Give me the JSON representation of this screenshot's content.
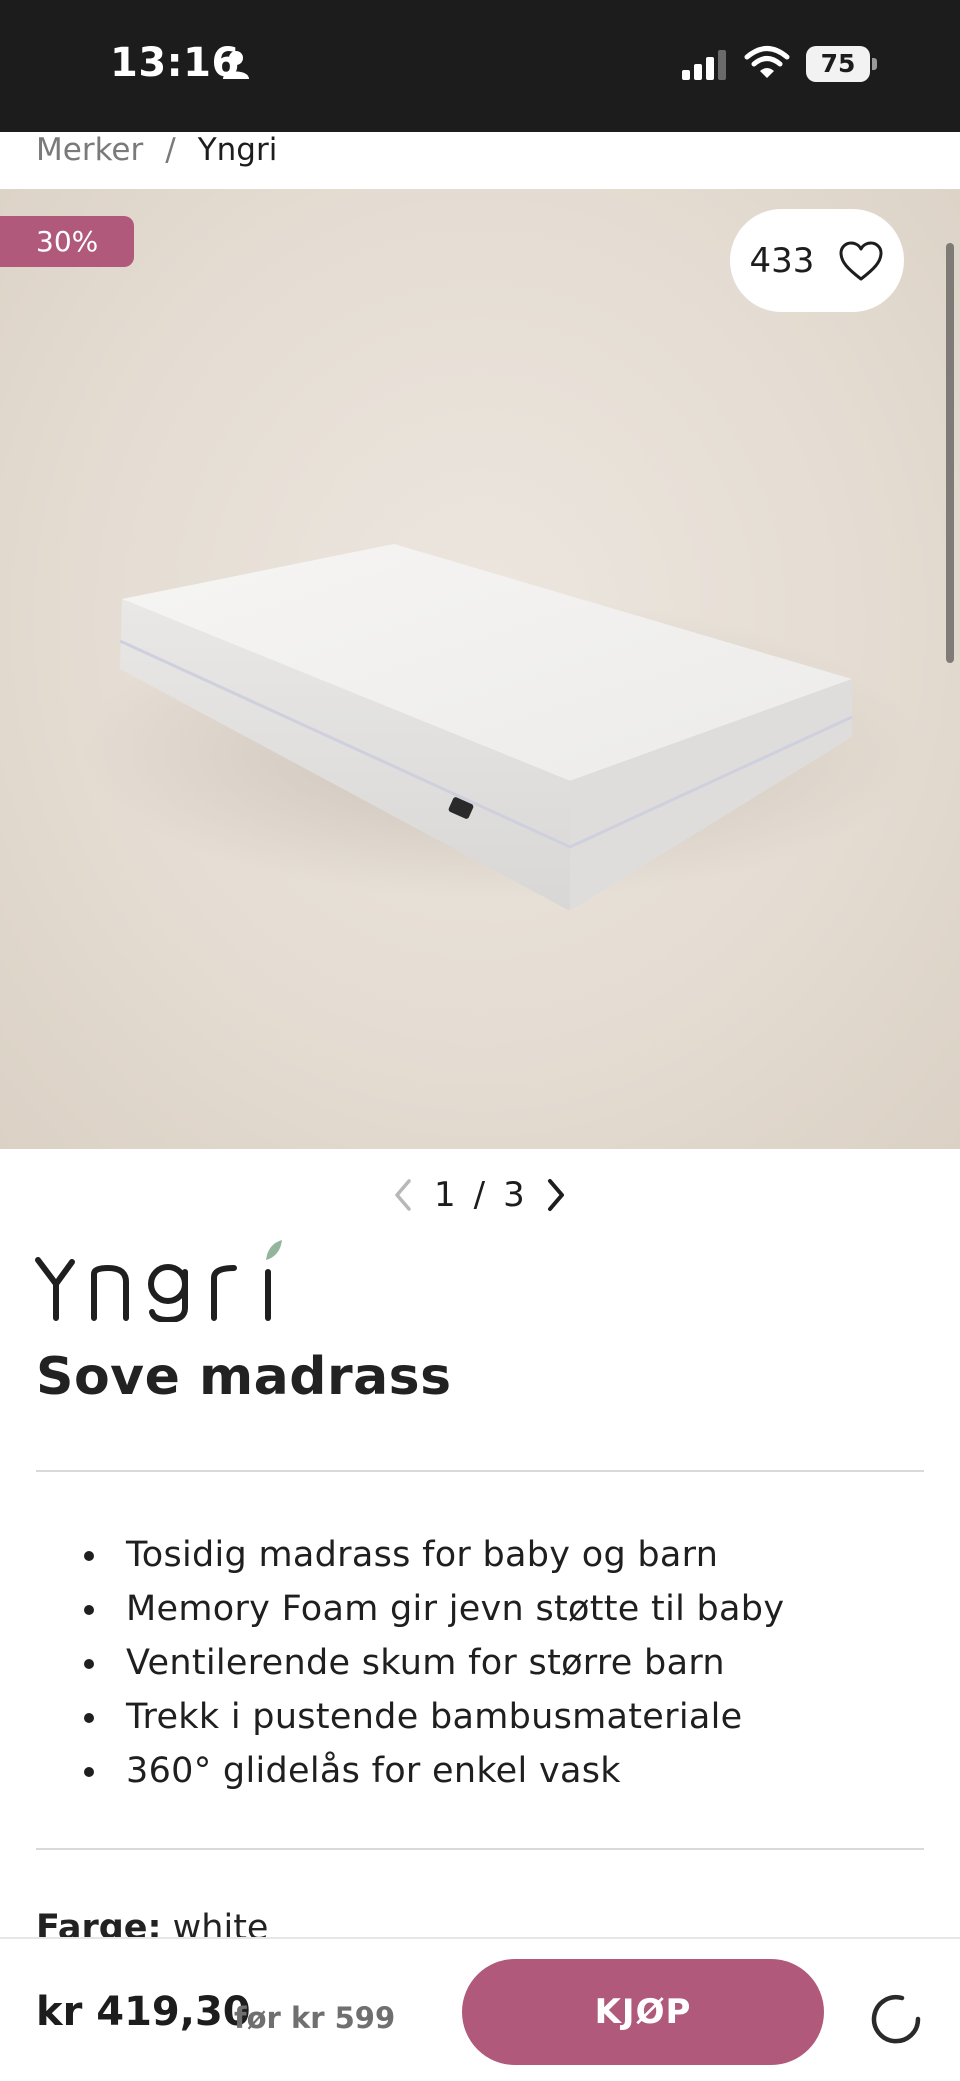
{
  "status_bar": {
    "time": "13:16",
    "battery": "75",
    "icons": [
      "person-icon",
      "signal-icon",
      "wifi-icon",
      "battery-icon"
    ]
  },
  "breadcrumb": {
    "parent": "Merker",
    "separator": "/",
    "current": "Yngri"
  },
  "gallery": {
    "discount": "30%",
    "likes": "433",
    "current": "1",
    "separator": "/",
    "total": "3"
  },
  "product": {
    "brand_logo_text": "Yngri",
    "title": "Sove madrass",
    "features": [
      "Tosidig madrass for baby og barn",
      "Memory Foam gir jevn støtte til baby",
      "Ventilerende skum for større barn",
      "Trekk i pustende bambusmateriale",
      "360° glidelås for enkel vask"
    ],
    "color_label": "Farge:",
    "color_value": "white"
  },
  "purchase": {
    "price": "kr 419,30",
    "before_price": "før kr 599",
    "buy_label": "KJØP"
  },
  "colors": {
    "accent": "#b0597a",
    "status_bar": "#1c1c1c",
    "text": "#1d1d1d"
  }
}
